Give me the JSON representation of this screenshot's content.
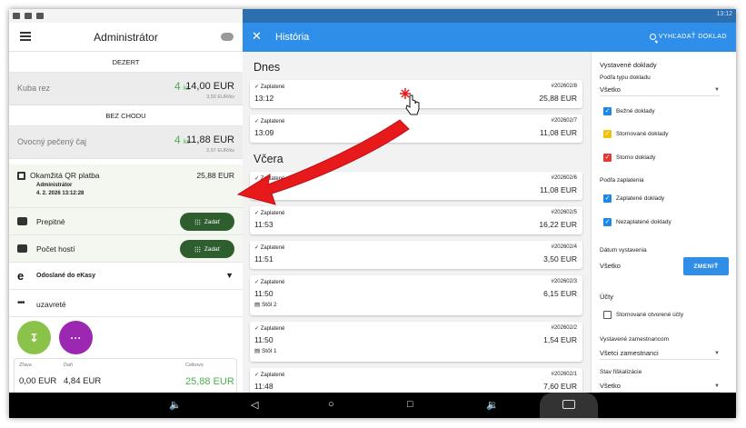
{
  "left": {
    "title": "Administrátor",
    "sections": [
      {
        "header": "DEZERT",
        "item": {
          "name": "Kuba rez",
          "qty": "4",
          "qty_unit": "ks",
          "price": "14,00 EUR",
          "unit_price": "3,50 EUR/ks"
        }
      },
      {
        "header": "BEZ CHODU",
        "item": {
          "name": "Ovocný pečený čaj",
          "qty": "4",
          "qty_unit": "ks",
          "price": "11,88 EUR",
          "unit_price": "2,97 EUR/ks"
        }
      }
    ],
    "qr_payment": {
      "title": "Okamžitá QR platba",
      "user": "Administrátor",
      "date": "4. 2. 2026 13:12:28",
      "amount": "25,88 EUR"
    },
    "tip_label": "Prepitné",
    "guests_label": "Počet hostí",
    "enter_label": "Zadať",
    "ekasy_logo": "e",
    "ekasy_label": "Odoslané do eKasy",
    "more_label": "uzavreté",
    "totals": {
      "discount_label": "Zľava",
      "discount_value": "0,00 EUR",
      "tax_label": "Daň",
      "tax_value": "4,84 EUR",
      "total_label": "Celkovo",
      "total_value": "25,88 EUR"
    }
  },
  "status": {
    "time": "13:12"
  },
  "history": {
    "title": "História",
    "close_icon": "✕",
    "search_label": "VYHĽADAŤ DOKLAD",
    "groups": [
      {
        "label": "Dnes",
        "docs": [
          {
            "status": "Zaplatené",
            "number": "#202602/8",
            "time": "13:12",
            "amount": "25,88 EUR",
            "table": ""
          },
          {
            "status": "Zaplatené",
            "number": "#202602/7",
            "time": "13:09",
            "amount": "11,08 EUR",
            "table": ""
          }
        ]
      },
      {
        "label": "Včera",
        "docs": [
          {
            "status": "Zaplatené",
            "number": "#202602/6",
            "time": "",
            "amount": "11,08 EUR",
            "table": ""
          },
          {
            "status": "Zaplatené",
            "number": "#202602/5",
            "time": "11:53",
            "amount": "16,22 EUR",
            "table": ""
          },
          {
            "status": "Zaplatené",
            "number": "#202602/4",
            "time": "11:51",
            "amount": "3,50 EUR",
            "table": ""
          },
          {
            "status": "Zaplatené",
            "number": "#202602/3",
            "time": "11:50",
            "amount": "6,15 EUR",
            "table": "Stôl 2"
          },
          {
            "status": "Zaplatené",
            "number": "#202602/2",
            "time": "11:50",
            "amount": "1,54 EUR",
            "table": "Stôl 1"
          },
          {
            "status": "Zaplatené",
            "number": "#202602/1",
            "time": "11:48",
            "amount": "7,60 EUR",
            "table": ""
          }
        ]
      }
    ]
  },
  "filter": {
    "issued_title": "Vystavené doklady",
    "type_label": "Podľa typu dokladu",
    "type_value": "Všetko",
    "type_options": [
      {
        "label": "Bežné doklady",
        "color": "#1e88e5"
      },
      {
        "label": "Stornované doklady",
        "color": "#f4c20d"
      },
      {
        "label": "Storno doklady",
        "color": "#e53935"
      }
    ],
    "payment_label": "Podľa zaplatenia",
    "payment_options": [
      {
        "label": "Zaplatené doklady",
        "color": "#1e88e5"
      },
      {
        "label": "Nezaplatené doklady",
        "color": "#1e88e5"
      }
    ],
    "date_label": "Dátum vystavenia",
    "date_value": "Všetko",
    "change_label": "ZMENIŤ",
    "accounts_label": "Účty",
    "canceled_open_label": "Stornované otvorené účty",
    "employee_label": "Vystavené zamestnancom",
    "employee_value": "Všetci zamestnanci",
    "fiscal_label": "Stav fiškalizácie",
    "fiscal_value": "Všetko"
  },
  "colors": {
    "app_blue": "#2f8fe8",
    "status_blue": "#2b6fb0",
    "green_button": "#2e5e2e",
    "green_text": "#4caf50",
    "fab_green": "#8bc34a",
    "fab_purple": "#9c27b0",
    "arrow_red": "#e8191b"
  }
}
